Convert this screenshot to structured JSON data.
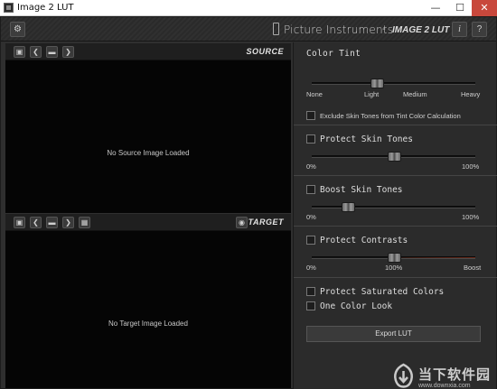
{
  "window": {
    "title": "Image 2 LUT",
    "minimize_glyph": "—",
    "maximize_glyph": "☐",
    "close_glyph": "✕"
  },
  "toolbar": {
    "gear_glyph": "⚙",
    "brand": "Picture Instruments",
    "separator": "-",
    "app_name": "IMAGE 2 LUT",
    "info_label": "i",
    "help_label": "?"
  },
  "source": {
    "label": "SOURCE",
    "empty_message": "No Source Image Loaded",
    "buttons": {
      "save": "▣",
      "prev": "❮",
      "folder": "▬",
      "next": "❯"
    }
  },
  "target": {
    "label": "TARGET",
    "empty_message": "No Target Image Loaded",
    "buttons": {
      "save": "▣",
      "prev": "❮",
      "folder": "▬",
      "next": "❯",
      "grid": "▦",
      "eye": "◉"
    }
  },
  "color_tint": {
    "title": "Color Tint",
    "value_fraction": 0.4,
    "ticks": [
      "None",
      "Light",
      "Medium",
      "Heavy"
    ],
    "exclude_skin_label": "Exclude Skin Tones from Tint Color Calculation",
    "exclude_skin_checked": false
  },
  "protect_skin": {
    "label": "Protect Skin Tones",
    "checked": false,
    "value_fraction": 0.5,
    "min_label": "0%",
    "max_label": "100%"
  },
  "boost_skin": {
    "label": "Boost Skin Tones",
    "checked": false,
    "value_fraction": 0.22,
    "min_label": "0%",
    "max_label": "100%"
  },
  "protect_contrasts": {
    "label": "Protect Contrasts",
    "checked": false,
    "value_fraction": 0.5,
    "min_label": "0%",
    "mid_label": "100%",
    "max_label": "Boost"
  },
  "protect_saturated": {
    "label": "Protect Saturated Colors",
    "checked": false
  },
  "one_color_look": {
    "label": "One Color Look",
    "checked": false
  },
  "export": {
    "label": "Export LUT"
  },
  "watermark": {
    "text": "当下软件园",
    "url": "www.downxia.com",
    "color": "#cfcfcf"
  }
}
